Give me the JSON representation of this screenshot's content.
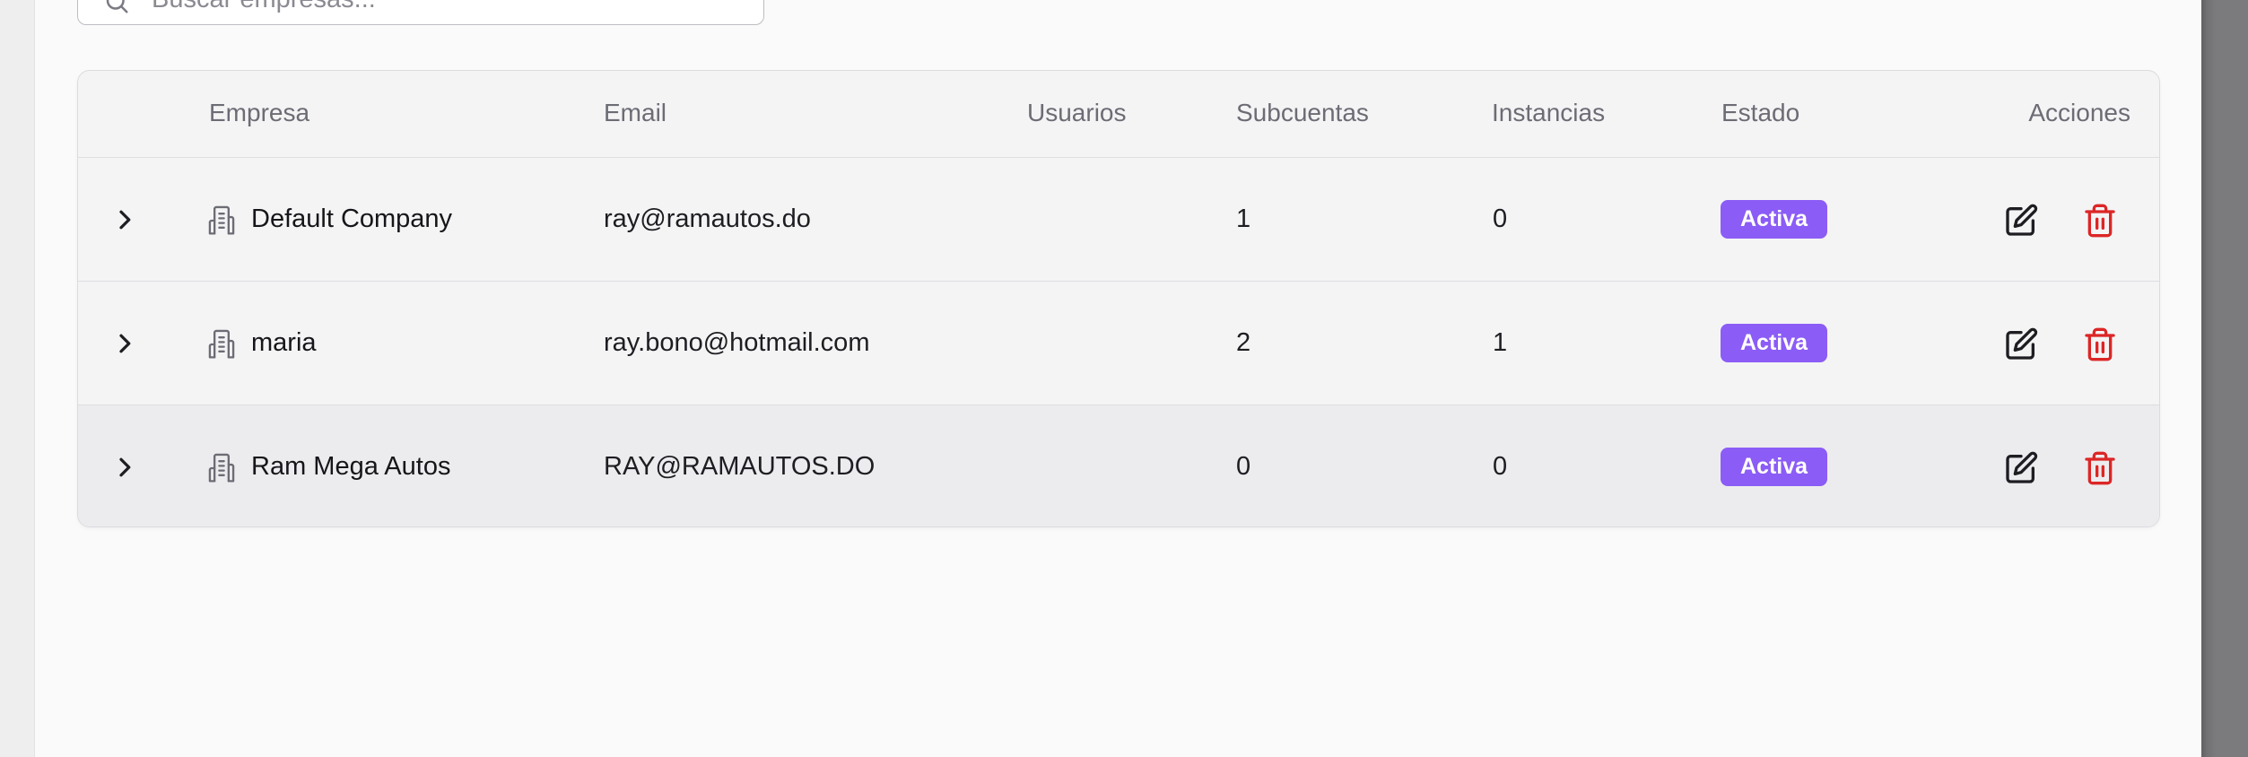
{
  "search": {
    "placeholder": "Buscar empresas..."
  },
  "table": {
    "columns": [
      "",
      "Empresa",
      "Email",
      "Usuarios",
      "Subcuentas",
      "Instancias",
      "Estado",
      "Acciones"
    ],
    "rows": [
      {
        "empresa": "Default Company",
        "email": "ray@ramautos.do",
        "usuarios": "",
        "subcuentas": "1",
        "instancias": "0",
        "estado": "Activa"
      },
      {
        "empresa": "maria",
        "email": "ray.bono@hotmail.com",
        "usuarios": "",
        "subcuentas": "2",
        "instancias": "1",
        "estado": "Activa"
      },
      {
        "empresa": "Ram Mega Autos",
        "email": "RAY@RAMAUTOS.DO",
        "usuarios": "",
        "subcuentas": "0",
        "instancias": "0",
        "estado": "Activa"
      }
    ]
  },
  "icons": {
    "search": "search-icon",
    "expand": "chevron-right-icon",
    "company": "building-icon",
    "edit": "edit-icon",
    "delete": "trash-icon"
  },
  "colors": {
    "badge": "#8b5cf6",
    "delete": "#dc2626",
    "panel_bg": "#fafafa",
    "table_bg": "#f4f4f5",
    "hover_row": "#ececee"
  }
}
